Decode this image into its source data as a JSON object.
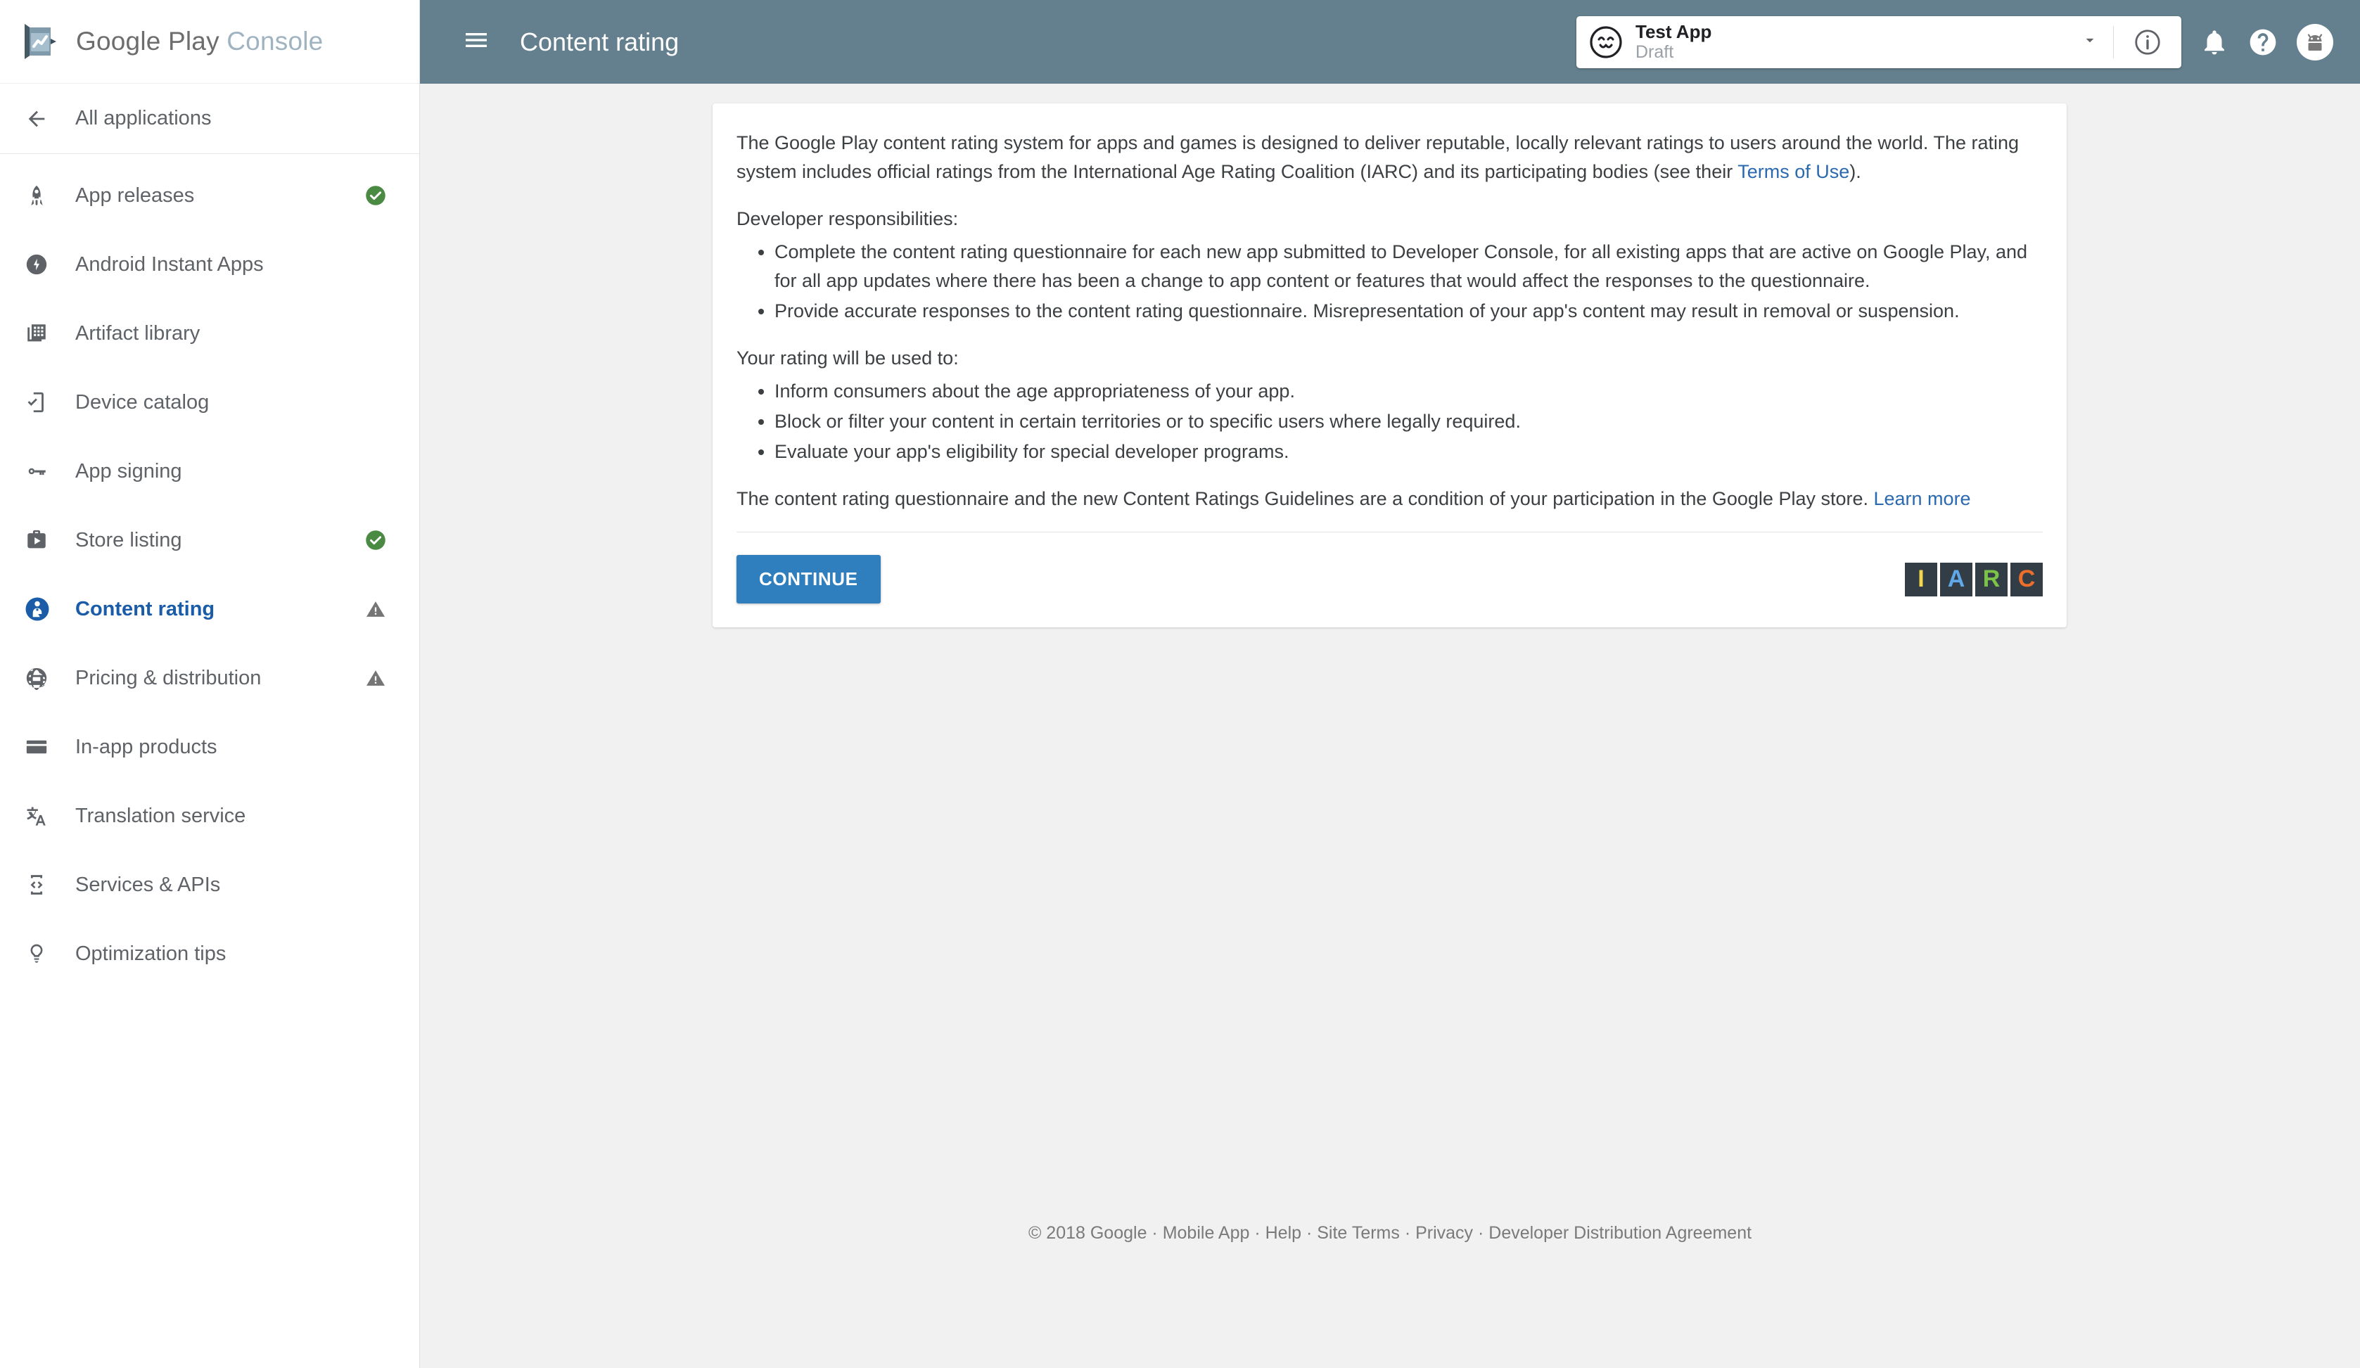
{
  "brand": {
    "name_primary": "Google Play",
    "name_secondary": "Console",
    "logo_icon": "play-console-logo-icon"
  },
  "sidebar": {
    "back": {
      "label": "All applications",
      "icon": "arrow-left-icon"
    },
    "items": [
      {
        "label": "App releases",
        "icon": "rocket-icon",
        "status": "check",
        "active": false
      },
      {
        "label": "Android Instant Apps",
        "icon": "bolt-circle-icon",
        "status": "",
        "active": false
      },
      {
        "label": "Artifact library",
        "icon": "library-icon",
        "status": "",
        "active": false
      },
      {
        "label": "Device catalog",
        "icon": "device-check-icon",
        "status": "",
        "active": false
      },
      {
        "label": "App signing",
        "icon": "key-icon",
        "status": "",
        "active": false
      },
      {
        "label": "Store listing",
        "icon": "store-icon",
        "status": "check",
        "active": false
      },
      {
        "label": "Content rating",
        "icon": "person-badge-icon",
        "status": "warn",
        "active": true
      },
      {
        "label": "Pricing & distribution",
        "icon": "globe-icon",
        "status": "warn",
        "active": false
      },
      {
        "label": "In-app products",
        "icon": "card-icon",
        "status": "",
        "active": false
      },
      {
        "label": "Translation service",
        "icon": "translate-icon",
        "status": "",
        "active": false
      },
      {
        "label": "Services & APIs",
        "icon": "code-device-icon",
        "status": "",
        "active": false
      },
      {
        "label": "Optimization tips",
        "icon": "lightbulb-icon",
        "status": "",
        "active": false
      }
    ]
  },
  "topbar": {
    "menu_icon": "hamburger-menu-icon",
    "title": "Content rating",
    "app": {
      "name": "Test App",
      "state": "Draft",
      "avatar_icon": "smiley-face-icon",
      "caret_icon": "chevron-down-icon"
    },
    "info_icon": "info-circle-icon",
    "notifications_icon": "bell-icon",
    "help_icon": "help-circle-icon",
    "account_icon": "android-avatar-icon"
  },
  "card": {
    "intro_a": "The Google Play content rating system for apps and games is designed to deliver reputable, locally relevant ratings to users around the world. The rating system includes official ratings from the International Age Rating Coalition (IARC) and its participating bodies (see their ",
    "intro_link": "Terms of Use",
    "intro_b": ").",
    "responsibilities_heading": "Developer responsibilities:",
    "responsibilities": [
      "Complete the content rating questionnaire for each new app submitted to Developer Console, for all existing apps that are active on Google Play, and for all app updates where there has been a change to app content or features that would affect the responses to the questionnaire.",
      "Provide accurate responses to the content rating questionnaire. Misrepresentation of your app's content may result in removal or suspension."
    ],
    "usage_heading": "Your rating will be used to:",
    "usage": [
      "Inform consumers about the age appropriateness of your app.",
      "Block or filter your content in certain territories or to specific users where legally required.",
      "Evaluate your app's eligibility for special developer programs."
    ],
    "closing_a": "The content rating questionnaire and the new Content Ratings Guidelines are a condition of your participation in the Google Play store. ",
    "closing_link": "Learn more",
    "continue_label": "CONTINUE",
    "iarc": {
      "letters": [
        "I",
        "A",
        "R",
        "C"
      ],
      "colors": [
        "#f2d74e",
        "#61a8e8",
        "#7cc24a",
        "#eb6e2a"
      ],
      "box_color": "#333d45"
    }
  },
  "footer": {
    "text": "© 2018 Google · Mobile App · Help · Site Terms · Privacy · Developer Distribution Agreement"
  },
  "colors": {
    "topbar": "#64808e",
    "page_background": "#f1f1f1",
    "primary_button": "#2f7ebd",
    "active_nav": "#1a5ca8",
    "status_ok": "#4a8a43",
    "status_warn": "#757575",
    "link": "#2a69b0"
  }
}
